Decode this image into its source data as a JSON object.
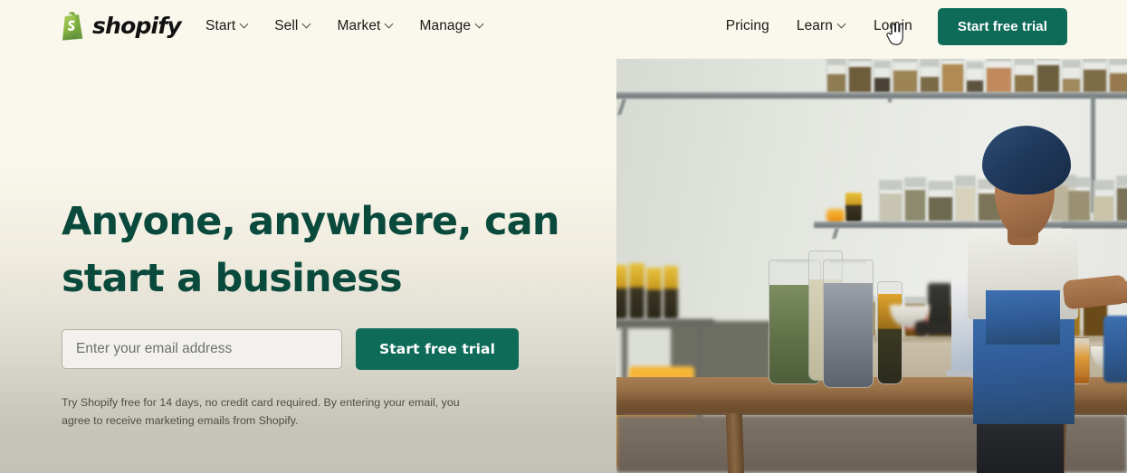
{
  "brand": {
    "name": "shopify",
    "logo_icon": "shopify-bag-icon",
    "logo_bag_color_light": "#95BF47",
    "logo_bag_color_dark": "#5E8E3E",
    "accent_color": "#0E6B57",
    "headline_color": "#0A4A3C",
    "page_background": "#FAF7EC"
  },
  "nav": {
    "primary": [
      {
        "label": "Start",
        "has_dropdown": true,
        "icon": "chevron-down-icon"
      },
      {
        "label": "Sell",
        "has_dropdown": true,
        "icon": "chevron-down-icon"
      },
      {
        "label": "Market",
        "has_dropdown": true,
        "icon": "chevron-down-icon"
      },
      {
        "label": "Manage",
        "has_dropdown": true,
        "icon": "chevron-down-icon"
      }
    ],
    "secondary": [
      {
        "label": "Pricing",
        "has_dropdown": false
      },
      {
        "label": "Learn",
        "has_dropdown": true,
        "icon": "chevron-down-icon"
      },
      {
        "label": "Log in",
        "has_dropdown": false
      }
    ],
    "cta_label": "Start free trial"
  },
  "cursor": {
    "icon": "pointer-hand-cursor",
    "over_element": "Log in"
  },
  "hero": {
    "headline": "Anyone, anywhere, can start a business",
    "email_placeholder": "Enter your email address",
    "email_value": "",
    "cta_label": "Start free trial",
    "disclaimer": "Try Shopify free for 14 days, no credit card required. By entering your email, you agree to receive marketing emails from Shopify.",
    "image_alt": "Woman in a blue head wrap working on a laptop at a wooden table with glass jars of herbs and spices on shelves behind her"
  }
}
